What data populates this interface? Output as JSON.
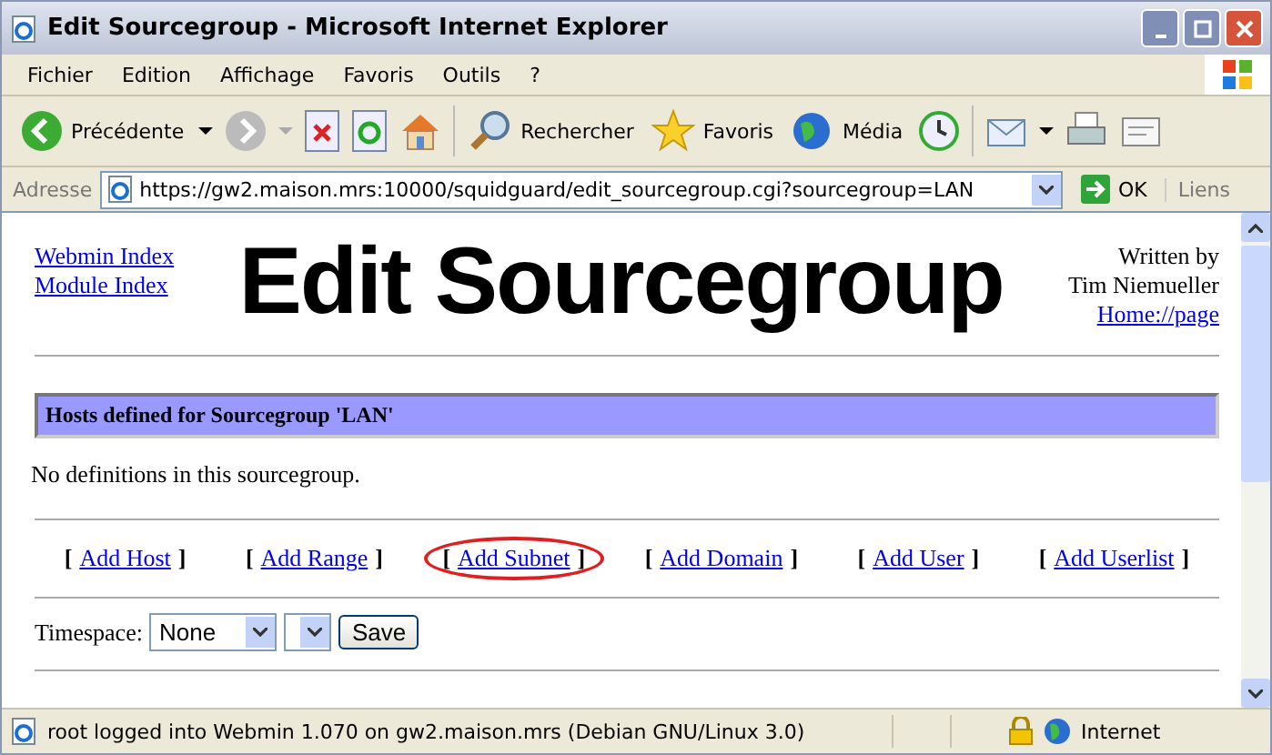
{
  "window": {
    "title": "Edit Sourcegroup - Microsoft Internet Explorer"
  },
  "menu": [
    "Fichier",
    "Edition",
    "Affichage",
    "Favoris",
    "Outils",
    "?"
  ],
  "toolbar": {
    "back": "Précédente",
    "search": "Rechercher",
    "favorites": "Favoris",
    "media": "Média"
  },
  "address_bar": {
    "label": "Adresse",
    "url": "https://gw2.maison.mrs:10000/squidguard/edit_sourcegroup.cgi?sourcegroup=LAN",
    "go": "OK",
    "links": "Liens"
  },
  "page": {
    "nav_links": [
      "Webmin Index",
      "Module Index"
    ],
    "heading": "Edit Sourcegroup",
    "credit": [
      "Written by",
      "Tim Niemueller"
    ],
    "home_link": "Home://page",
    "section_header": "Hosts defined for Sourcegroup 'LAN'",
    "empty_message": "No definitions in this sourcegroup.",
    "actions": [
      {
        "open": "[",
        "label": "Add Host",
        "close": "]",
        "circled": false
      },
      {
        "open": "[",
        "label": "Add Range",
        "close": "]",
        "circled": false
      },
      {
        "open": "[",
        "label": "Add Subnet",
        "close": "]",
        "circled": true
      },
      {
        "open": "[",
        "label": "Add Domain",
        "close": "]",
        "circled": false
      },
      {
        "open": "[",
        "label": "Add User",
        "close": "]",
        "circled": false
      },
      {
        "open": "[",
        "label": "Add Userlist",
        "close": "]",
        "circled": false
      }
    ],
    "timespace": {
      "label": "Timespace:",
      "value": "None",
      "save": "Save"
    }
  },
  "status_bar": {
    "text": "root logged into Webmin 1.070 on gw2.maison.mrs (Debian GNU/Linux 3.0)",
    "zone": "Internet"
  }
}
